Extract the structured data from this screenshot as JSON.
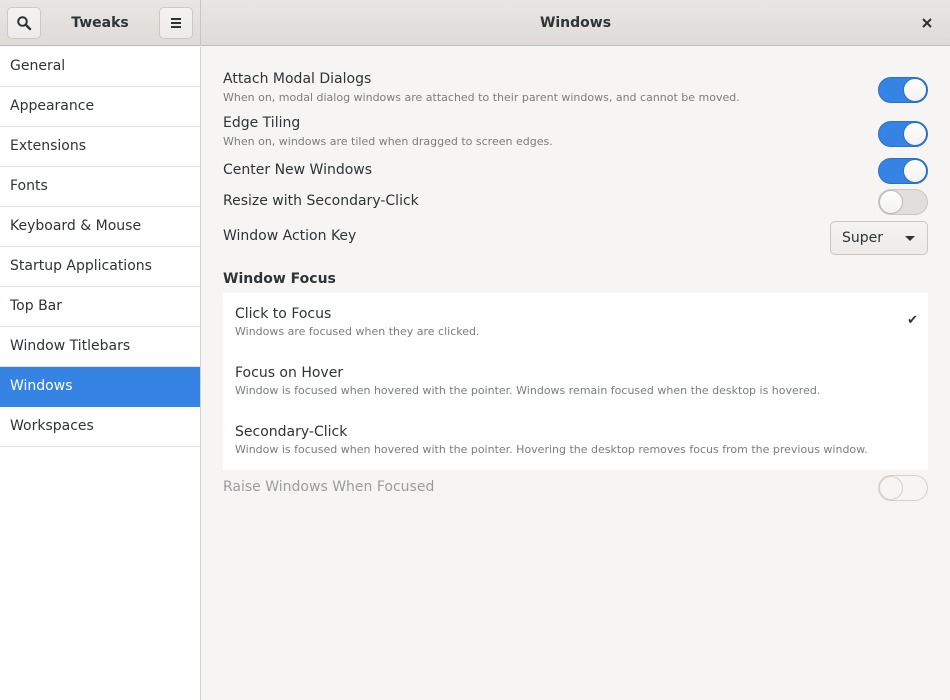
{
  "header": {
    "app_title": "Tweaks",
    "page_title": "Windows",
    "search_icon": "search-icon",
    "menu_icon": "hamburger-menu-icon",
    "close_icon": "close-icon",
    "close_glyph": "×"
  },
  "sidebar": {
    "items": [
      {
        "label": "General",
        "active": false
      },
      {
        "label": "Appearance",
        "active": false
      },
      {
        "label": "Extensions",
        "active": false
      },
      {
        "label": "Fonts",
        "active": false
      },
      {
        "label": "Keyboard & Mouse",
        "active": false
      },
      {
        "label": "Startup Applications",
        "active": false
      },
      {
        "label": "Top Bar",
        "active": false
      },
      {
        "label": "Window Titlebars",
        "active": false
      },
      {
        "label": "Windows",
        "active": true
      },
      {
        "label": "Workspaces",
        "active": false
      }
    ]
  },
  "settings": {
    "attach_modal": {
      "title": "Attach Modal Dialogs",
      "description": "When on, modal dialog windows are attached to their parent windows, and cannot be moved.",
      "enabled": true
    },
    "edge_tiling": {
      "title": "Edge Tiling",
      "description": "When on, windows are tiled when dragged to screen edges.",
      "enabled": true
    },
    "center_new": {
      "title": "Center New Windows",
      "enabled": true
    },
    "resize_secondary": {
      "title": "Resize with Secondary-Click",
      "enabled": false
    },
    "action_key": {
      "title": "Window Action Key",
      "value": "Super"
    }
  },
  "window_focus": {
    "heading": "Window Focus",
    "options": [
      {
        "title": "Click to Focus",
        "description": "Windows are focused when they are clicked.",
        "selected": true
      },
      {
        "title": "Focus on Hover",
        "description": "Window is focused when hovered with the pointer. Windows remain focused when the desktop is hovered.",
        "selected": false
      },
      {
        "title": "Secondary-Click",
        "description": "Window is focused when hovered with the pointer. Hovering the desktop removes focus from the previous window.",
        "selected": false
      }
    ],
    "check_glyph": "✔",
    "raise": {
      "title": "Raise Windows When Focused",
      "enabled": false,
      "sensitive": false
    }
  },
  "colors": {
    "accent": "#3584e4",
    "background": "#f6f5f4",
    "text": "#2e3436",
    "dim_text": "#7a7d7e"
  }
}
